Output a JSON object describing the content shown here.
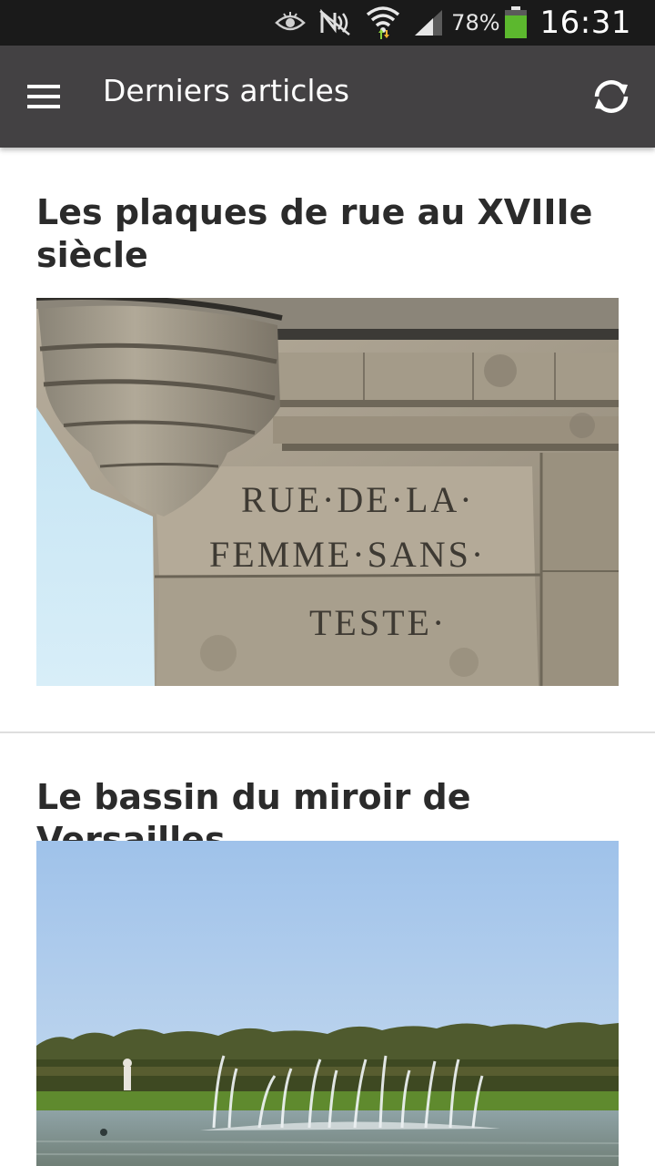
{
  "status_bar": {
    "battery_percent": "78%",
    "time": "16:31",
    "icons": [
      "eye-icon",
      "nfc-icon",
      "wifi-icon",
      "signal-icon",
      "battery-icon"
    ],
    "battery_color": "#5cb82e"
  },
  "app_bar": {
    "title": "Derniers articles",
    "menu_icon": "hamburger-menu-icon",
    "refresh_icon": "refresh-icon",
    "background": "#434143"
  },
  "articles": [
    {
      "title": "Les plaques de rue au XVIIIe siècle",
      "image_inscription": [
        "RUE·DE·LA·",
        "FEMME·SANS·",
        "TESTE·"
      ]
    },
    {
      "title": "Le bassin du miroir de Versailles"
    }
  ]
}
